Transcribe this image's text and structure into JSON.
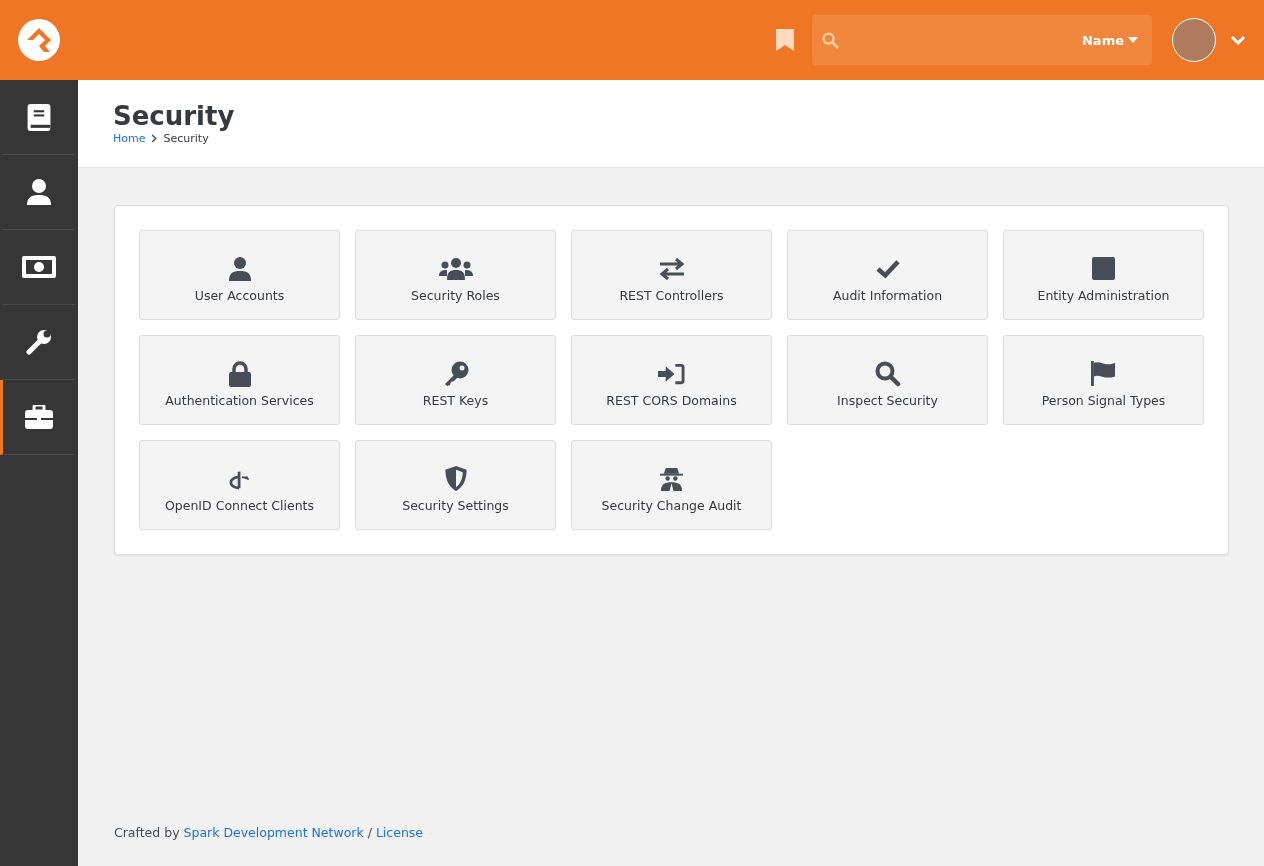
{
  "header": {
    "search": {
      "filter": "Name"
    }
  },
  "sidebar": {
    "items": [
      {
        "selected": false
      },
      {
        "selected": false
      },
      {
        "selected": false
      },
      {
        "selected": false
      },
      {
        "selected": true
      }
    ]
  },
  "page": {
    "title": "Security",
    "breadcrumbs": [
      "Home",
      "Security"
    ]
  },
  "tiles": [
    {
      "label": "User Accounts"
    },
    {
      "label": "Security Roles"
    },
    {
      "label": "REST Controllers"
    },
    {
      "label": "Audit Information"
    },
    {
      "label": "Entity Administration"
    },
    {
      "label": "Authentication Services"
    },
    {
      "label": "REST Keys"
    },
    {
      "label": "REST CORS Domains"
    },
    {
      "label": "Inspect Security"
    },
    {
      "label": "Person Signal Types"
    },
    {
      "label": "OpenID Connect Clients"
    },
    {
      "label": "Security Settings"
    },
    {
      "label": "Security Change Audit"
    }
  ],
  "footer": {
    "text": "Crafted by",
    "link": "Spark Development Network",
    "separator": "/",
    "license": "License"
  }
}
